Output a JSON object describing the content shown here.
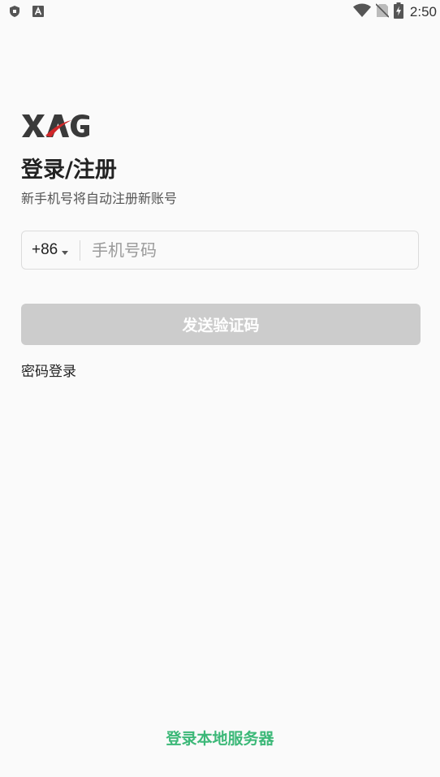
{
  "status_bar": {
    "time": "2:50",
    "left_icons": [
      "shield-icon",
      "app-a-icon"
    ],
    "right_icons": [
      "wifi-icon",
      "no-sim-icon",
      "battery-charging-icon"
    ]
  },
  "brand": {
    "logo_text": "XAG",
    "logo_color": "#3a3a3a",
    "logo_accent_color": "#d0282a"
  },
  "login": {
    "title": "登录/注册",
    "subtitle": "新手机号将自动注册新账号",
    "country_code": "+86",
    "phone_placeholder": "手机号码",
    "phone_value": "",
    "send_code_label": "发送验证码",
    "password_login_label": "密码登录",
    "local_server_label": "登录本地服务器"
  },
  "colors": {
    "background": "#fafafa",
    "button_disabled": "#cccccc",
    "accent_green": "#3cb878"
  }
}
